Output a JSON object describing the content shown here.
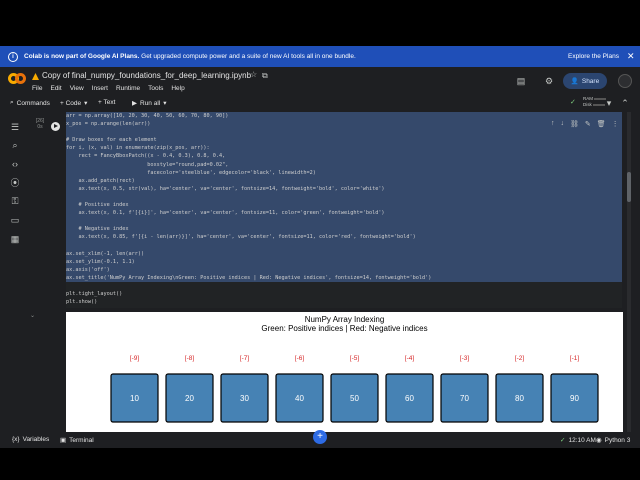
{
  "banner": {
    "bold": "Colab is now part of Google AI Plans.",
    "rest": " Get upgraded compute power and a suite of new AI tools all in one bundle.",
    "explore": "Explore the Plans",
    "close": "✕"
  },
  "header": {
    "notebook_title": "Copy of final_numpy_foundations_for_deep_learning.ipynb",
    "menus": [
      "File",
      "Edit",
      "View",
      "Insert",
      "Runtime",
      "Tools",
      "Help"
    ],
    "share_label": "Share"
  },
  "toolbar": {
    "commands": "Commands",
    "code": "+ Code",
    "text": "+ Text",
    "run_all": "Run all",
    "ram": "RAM",
    "disk": "Disk"
  },
  "cell": {
    "exec_count": "[26]",
    "exec_time": "0s",
    "lines": [
      {
        "t": "arr = np.array([10, 20, 30, 40, 50, 60, 70, 80, 90])",
        "sel": true
      },
      {
        "t": "x_pos = np.arange(len(arr))",
        "sel": true
      },
      {
        "t": "",
        "sel": true
      },
      {
        "t": "# Draw boxes for each element",
        "sel": true
      },
      {
        "t": "for i, (x, val) in enumerate(zip(x_pos, arr)):",
        "sel": true
      },
      {
        "t": "    rect = FancyBboxPatch((x - 0.4, 0.3), 0.8, 0.4,",
        "sel": true
      },
      {
        "t": "                          boxstyle=\"round,pad=0.02\",",
        "sel": true
      },
      {
        "t": "                          facecolor='steelblue', edgecolor='black', linewidth=2)",
        "sel": true
      },
      {
        "t": "    ax.add_patch(rect)",
        "sel": true
      },
      {
        "t": "    ax.text(x, 0.5, str(val), ha='center', va='center', fontsize=14, fontweight='bold', color='white')",
        "sel": true
      },
      {
        "t": "",
        "sel": true
      },
      {
        "t": "    # Positive index",
        "sel": true
      },
      {
        "t": "    ax.text(x, 0.1, f'[{i}]', ha='center', va='center', fontsize=11, color='green', fontweight='bold')",
        "sel": true
      },
      {
        "t": "",
        "sel": true
      },
      {
        "t": "    # Negative index",
        "sel": true
      },
      {
        "t": "    ax.text(x, 0.85, f'[{i - len(arr)}]', ha='center', va='center', fontsize=11, color='red', fontweight='bold')",
        "sel": true
      },
      {
        "t": "",
        "sel": true
      },
      {
        "t": "ax.set_xlim(-1, len(arr))",
        "sel": true
      },
      {
        "t": "ax.set_ylim(-0.1, 1.1)",
        "sel": true
      },
      {
        "t": "ax.axis('off')",
        "sel": true
      },
      {
        "t": "ax.set_title('NumPy Array Indexing\\nGreen: Positive indices | Red: Negative indices', fontsize=14, fontweight='bold')",
        "sel": true
      },
      {
        "t": "",
        "sel": false
      },
      {
        "t": "plt.tight_layout()",
        "sel": false
      },
      {
        "t": "plt.show()",
        "sel": false
      }
    ]
  },
  "output": {
    "title_line1": "NumPy Array Indexing",
    "title_line2": "Green: Positive indices | Red: Negative indices"
  },
  "chart_data": {
    "type": "table",
    "values": [
      10,
      20,
      30,
      40,
      50,
      60,
      70,
      80,
      90
    ],
    "negative_indices": [
      "[-9]",
      "[-8]",
      "[-7]",
      "[-6]",
      "[-5]",
      "[-4]",
      "[-3]",
      "[-2]",
      "[-1]"
    ],
    "box_color": "#4682b4",
    "index_color": "#d62728"
  },
  "status": {
    "variables": "Variables",
    "terminal": "Terminal",
    "time": "12:10 AM",
    "python": "Python 3"
  },
  "colors": {
    "accent": "#1f4fb8",
    "selection": "#35496b",
    "share_bg": "#2b4570"
  }
}
